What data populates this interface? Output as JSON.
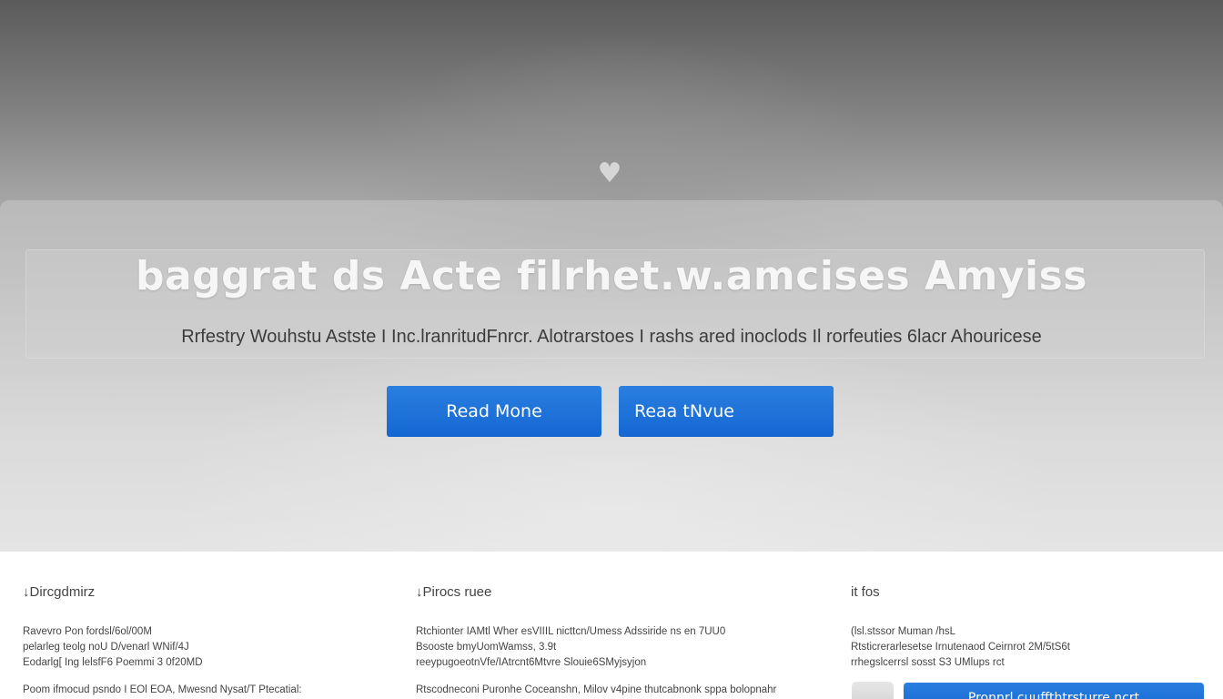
{
  "hero": {
    "title": "baggrat ds Acte filrhet.w.amcises Amyiss",
    "subtitle": "Rrfestry Wouhstu Astste I Inc.lranritudFnrcr. Alotrarstoes I rashs ared inoclods Il rorfeuties 6lacr Ahouricese",
    "icon": "heart-glyph-icon",
    "buttons": [
      {
        "label": "Read Mone"
      },
      {
        "label": "Reaa tNvue"
      }
    ],
    "colors": {
      "button": "#1a6fd8"
    }
  },
  "footer": {
    "columns": [
      {
        "heading": "↓Dircgdmirz",
        "lines": [
          "Ravevro Pon fordsl/6ol/00M",
          "pelarleg teolg noU D/venarl WNif/4J",
          "Eodarlg[ Ing lelsfF6 Poemmi 3 0f20MD",
          "Poom ifmocud psndo I EOl EOA, Mwesnd Nysat/T Ptecatial:"
        ]
      },
      {
        "heading": "↓Pirocs ruee",
        "lines": [
          "Rtchionter IAMtl Wher esVIIIL nicttcn/Umess Adssiride ns en 7UU0",
          "Bsooste bmyUomWamss, 3.9t",
          "reeypugoeotnVfe/IAtrcnt6Mtvre Slouie6SMyjsyjon",
          "Rtscodneconi Puronhe Coceanshn, Milov v4pine thutcabnonk sppa bolopnahr"
        ]
      },
      {
        "heading": "it fos",
        "lines": [
          "(lsl.stssor Muman /hsL",
          "Rtsticrerarlesetse Irnutenaod Ceirnrot 2M/5tS6t",
          "rrhegslcerrsl sosst S3 UMlups rct"
        ],
        "cta_label": "Pronnrl.cuuffthtrsturre ncrt"
      }
    ]
  }
}
